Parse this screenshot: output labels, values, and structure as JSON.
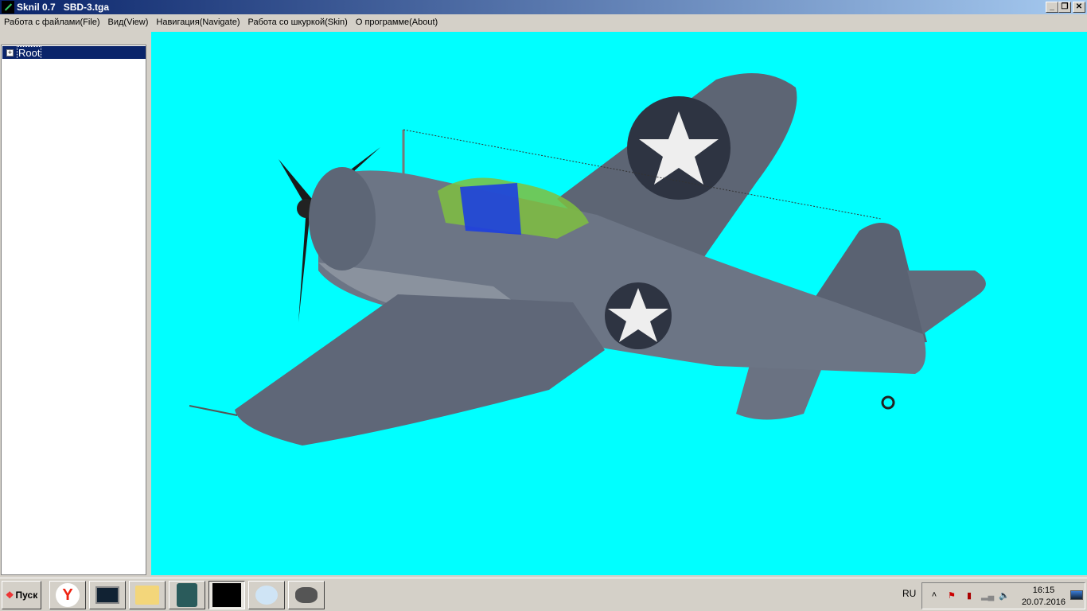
{
  "window": {
    "title": "Sknil 0.7   SBD-3.tga",
    "minimize": "_",
    "maximize": "❐",
    "close": "✕"
  },
  "menu": [
    "Работа с файлами(File)",
    "Вид(View)",
    "Навигация(Navigate)",
    "Работа со шкуркой(Skin)",
    "О программе(About)"
  ],
  "tree": {
    "root": "Root",
    "expander": "+"
  },
  "viewport": {
    "background": "#00ffff",
    "model": "SBD-3 Dauntless aircraft"
  },
  "taskbar": {
    "start": "Пуск",
    "apps": [
      "yandex-browser",
      "resource-monitor",
      "windows-explorer",
      "security-app",
      "sknil",
      "paint",
      "gimp"
    ],
    "lang": "RU",
    "time": "16:15",
    "date": "20.07.2016"
  }
}
